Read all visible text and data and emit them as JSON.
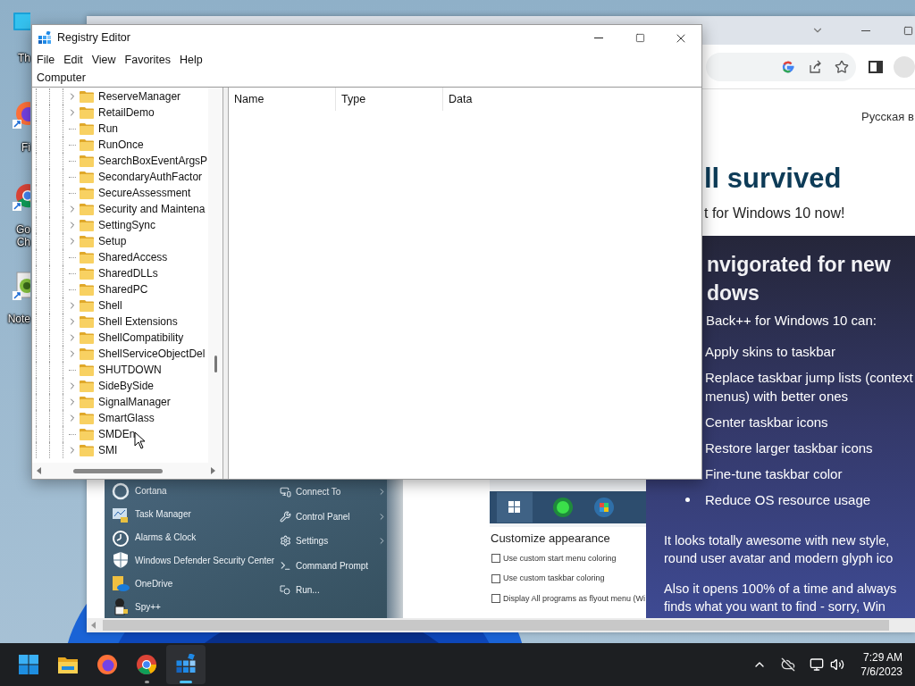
{
  "desktop_icons": [
    {
      "label_lines": [
        "Th"
      ]
    },
    {
      "label_lines": [
        "Fi"
      ]
    },
    {
      "label_lines": [
        "Go",
        "Ch"
      ]
    },
    {
      "label_lines": [
        "Note"
      ]
    }
  ],
  "browser": {
    "header_link": "Русская в",
    "heading": "ll survived",
    "subtitle": "t for Windows 10 now!",
    "section": {
      "heading_lines": [
        "nvigorated for new",
        "dows"
      ],
      "intro": "Back++ for Windows 10 can:",
      "features": [
        {
          "lines": [
            "Apply skins to taskbar"
          ]
        },
        {
          "lines": [
            "Replace taskbar jump lists (context",
            "menus) with better ones"
          ]
        },
        {
          "lines": [
            "Center taskbar icons"
          ]
        },
        {
          "lines": [
            "Restore larger taskbar icons"
          ]
        },
        {
          "lines": [
            "Fine-tune taskbar color"
          ]
        },
        {
          "lines": [
            "Reduce OS resource usage"
          ]
        }
      ],
      "paragraphs": [
        {
          "lines": [
            "It looks totally awesome with new style,",
            "round user avatar and modern glyph ico"
          ]
        },
        {
          "lines": [
            "Also it opens 100% of a time and always",
            "finds what you want to find - sorry, Win"
          ]
        }
      ]
    },
    "start_menu_shot": {
      "left_items": [
        "Cortana",
        "Task Manager",
        "Alarms & Clock",
        "Windows Defender Security Center",
        "OneDrive",
        "Spy++"
      ],
      "right_items": [
        {
          "label": "Connect To",
          "submenu": true
        },
        {
          "label": "Control Panel",
          "submenu": true
        },
        {
          "label": "Settings",
          "submenu": true
        },
        {
          "label": "Command Prompt",
          "submenu": false
        },
        {
          "label": "Run...",
          "submenu": false
        }
      ]
    },
    "settings_shot": {
      "title": "Customize appearance",
      "options": [
        {
          "label": "Use custom start menu coloring",
          "checked": false
        },
        {
          "label": "Use custom taskbar coloring",
          "checked": false
        },
        {
          "label": "Display All programs as flyout menu (Wi",
          "checked": false
        }
      ]
    }
  },
  "regedit": {
    "title": "Registry Editor",
    "menu": [
      "File",
      "Edit",
      "View",
      "Favorites",
      "Help"
    ],
    "address": "Computer",
    "tree": [
      {
        "label": "ReserveManager",
        "has_children": true
      },
      {
        "label": "RetailDemo",
        "has_children": true
      },
      {
        "label": "Run",
        "has_children": false
      },
      {
        "label": "RunOnce",
        "has_children": false
      },
      {
        "label": "SearchBoxEventArgsP",
        "has_children": false
      },
      {
        "label": "SecondaryAuthFactor",
        "has_children": false
      },
      {
        "label": "SecureAssessment",
        "has_children": false
      },
      {
        "label": "Security and Maintena",
        "has_children": true
      },
      {
        "label": "SettingSync",
        "has_children": true
      },
      {
        "label": "Setup",
        "has_children": true
      },
      {
        "label": "SharedAccess",
        "has_children": false
      },
      {
        "label": "SharedDLLs",
        "has_children": false
      },
      {
        "label": "SharedPC",
        "has_children": false
      },
      {
        "label": "Shell",
        "has_children": true
      },
      {
        "label": "Shell Extensions",
        "has_children": true
      },
      {
        "label": "ShellCompatibility",
        "has_children": true
      },
      {
        "label": "ShellServiceObjectDel",
        "has_children": true
      },
      {
        "label": "SHUTDOWN",
        "has_children": false
      },
      {
        "label": "SideBySide",
        "has_children": true
      },
      {
        "label": "SignalManager",
        "has_children": true
      },
      {
        "label": "SmartGlass",
        "has_children": true
      },
      {
        "label": "SMDEn",
        "has_children": false
      },
      {
        "label": "SMI",
        "has_children": true
      }
    ],
    "columns": [
      "Name",
      "Type",
      "Data"
    ]
  },
  "taskbar": {
    "apps": [
      {
        "running": false,
        "active": false
      },
      {
        "running": false,
        "active": false
      },
      {
        "running": false,
        "active": false
      },
      {
        "running": true,
        "active": false
      },
      {
        "running": true,
        "active": true
      }
    ],
    "time": "7:29 AM",
    "date": "7/6/2023"
  }
}
